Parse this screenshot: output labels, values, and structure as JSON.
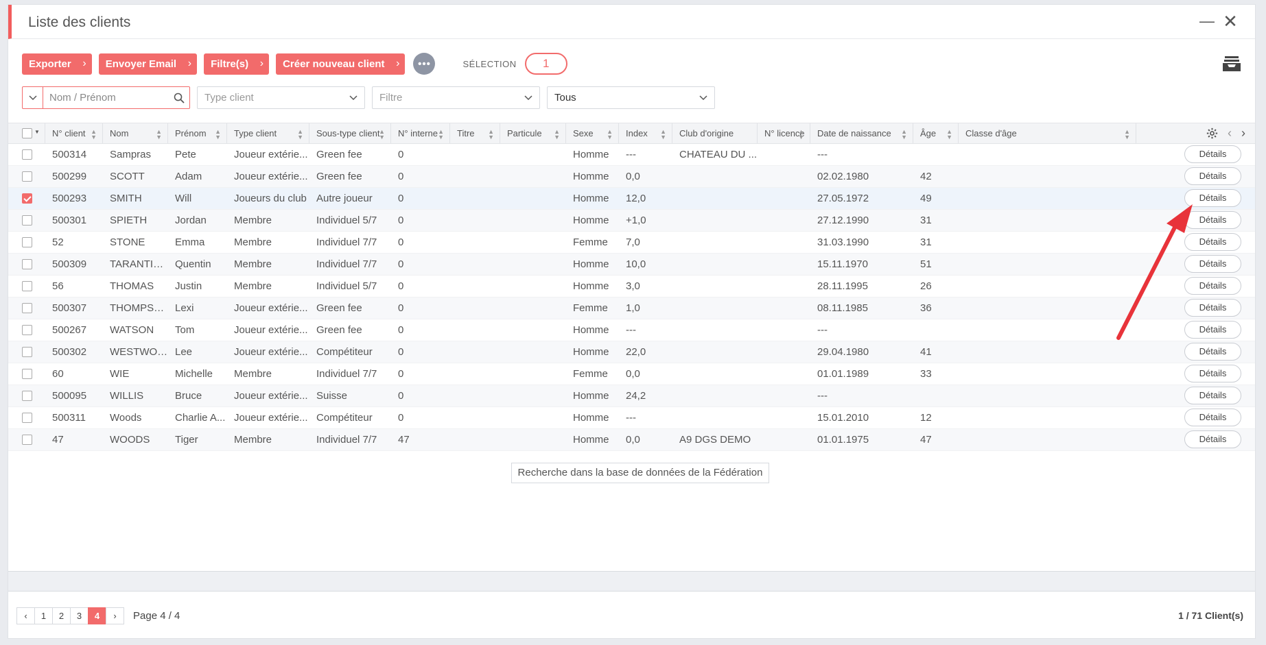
{
  "window": {
    "title": "Liste des clients",
    "min_glyph": "—",
    "close_glyph": "✕"
  },
  "toolbar": {
    "buttons": [
      "Exporter",
      "Envoyer Email",
      "Filtre(s)",
      "Créer nouveau client"
    ],
    "more_glyph": "•••",
    "selection_label": "SÉLECTION",
    "selection_count": "1"
  },
  "filters": {
    "search_placeholder": "Nom / Prénom",
    "type_client": "Type client",
    "filtre": "Filtre",
    "tous": "Tous"
  },
  "grid": {
    "columns": [
      "N° client",
      "Nom",
      "Prénom",
      "Type client",
      "Sous-type client",
      "N° interne",
      "Titre",
      "Particule",
      "Sexe",
      "Index",
      "Club d'origine",
      "N° licence",
      "Date de naissance",
      "Âge",
      "Classe d'âge"
    ],
    "details_label": "Détails",
    "rows": [
      {
        "checked": false,
        "cells": [
          "500314",
          "Sampras",
          "Pete",
          "Joueur extérie...",
          "Green fee",
          "0",
          "",
          "",
          "Homme",
          "---",
          "CHATEAU DU ...",
          "",
          "---",
          "",
          ""
        ]
      },
      {
        "checked": false,
        "cells": [
          "500299",
          "SCOTT",
          "Adam",
          "Joueur extérie...",
          "Green fee",
          "0",
          "",
          "",
          "Homme",
          "0,0",
          "",
          "",
          "02.02.1980",
          "42",
          ""
        ]
      },
      {
        "checked": true,
        "cells": [
          "500293",
          "SMITH",
          "Will",
          "Joueurs du club",
          "Autre joueur",
          "0",
          "",
          "",
          "Homme",
          "12,0",
          "",
          "",
          "27.05.1972",
          "49",
          ""
        ]
      },
      {
        "checked": false,
        "cells": [
          "500301",
          "SPIETH",
          "Jordan",
          "Membre",
          "Individuel 5/7",
          "0",
          "",
          "",
          "Homme",
          "+1,0",
          "",
          "",
          "27.12.1990",
          "31",
          ""
        ]
      },
      {
        "checked": false,
        "cells": [
          "52",
          "STONE",
          "Emma",
          "Membre",
          "Individuel 7/7",
          "0",
          "",
          "",
          "Femme",
          "7,0",
          "",
          "",
          "31.03.1990",
          "31",
          ""
        ]
      },
      {
        "checked": false,
        "cells": [
          "500309",
          "TARANTINO",
          "Quentin",
          "Membre",
          "Individuel 7/7",
          "0",
          "",
          "",
          "Homme",
          "10,0",
          "",
          "",
          "15.11.1970",
          "51",
          ""
        ]
      },
      {
        "checked": false,
        "cells": [
          "56",
          "THOMAS",
          "Justin",
          "Membre",
          "Individuel 5/7",
          "0",
          "",
          "",
          "Homme",
          "3,0",
          "",
          "",
          "28.11.1995",
          "26",
          ""
        ]
      },
      {
        "checked": false,
        "cells": [
          "500307",
          "THOMPSON",
          "Lexi",
          "Joueur extérie...",
          "Green fee",
          "0",
          "",
          "",
          "Femme",
          "1,0",
          "",
          "",
          "08.11.1985",
          "36",
          ""
        ]
      },
      {
        "checked": false,
        "cells": [
          "500267",
          "WATSON",
          "Tom",
          "Joueur extérie...",
          "Green fee",
          "0",
          "",
          "",
          "Homme",
          "---",
          "",
          "",
          "---",
          "",
          ""
        ]
      },
      {
        "checked": false,
        "cells": [
          "500302",
          "WESTWOOD",
          "Lee",
          "Joueur extérie...",
          "Compétiteur",
          "0",
          "",
          "",
          "Homme",
          "22,0",
          "",
          "",
          "29.04.1980",
          "41",
          ""
        ]
      },
      {
        "checked": false,
        "cells": [
          "60",
          "WIE",
          "Michelle",
          "Membre",
          "Individuel 7/7",
          "0",
          "",
          "",
          "Femme",
          "0,0",
          "",
          "",
          "01.01.1989",
          "33",
          ""
        ]
      },
      {
        "checked": false,
        "cells": [
          "500095",
          "WILLIS",
          "Bruce",
          "Joueur extérie...",
          "Suisse",
          "0",
          "",
          "",
          "Homme",
          "24,2",
          "",
          "",
          "---",
          "",
          ""
        ]
      },
      {
        "checked": false,
        "cells": [
          "500311",
          "Woods",
          "Charlie A...",
          "Joueur extérie...",
          "Compétiteur",
          "0",
          "",
          "",
          "Homme",
          "---",
          "",
          "",
          "15.01.2010",
          "12",
          ""
        ]
      },
      {
        "checked": false,
        "cells": [
          "47",
          "WOODS",
          "Tiger",
          "Membre",
          "Individuel 7/7",
          "47",
          "",
          "",
          "Homme",
          "0,0",
          "A9 DGS DEMO",
          "",
          "01.01.1975",
          "47",
          ""
        ]
      }
    ]
  },
  "federation_button": "Recherche dans la base de données de la Fédération",
  "pager": {
    "pages": [
      "1",
      "2",
      "3",
      "4"
    ],
    "active": "4",
    "prev": "‹",
    "next": "›",
    "label": "Page 4 / 4"
  },
  "count_label": "1 / 71 Client(s)",
  "colors": {
    "accent": "#f26b6b",
    "arrow": "#e8333a"
  }
}
